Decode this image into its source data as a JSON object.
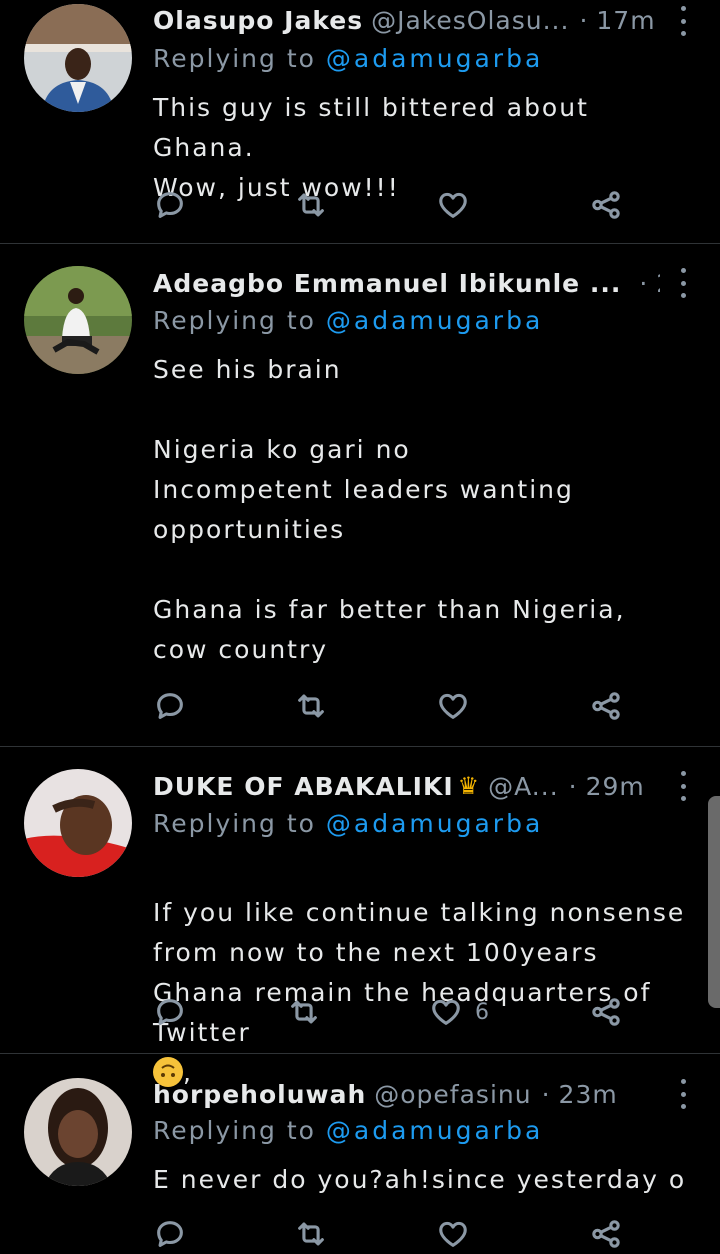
{
  "tweets": [
    {
      "name": "Olasupo Jakes",
      "handle": "@JakesOlasu...",
      "time": "17m",
      "replying_label": "Replying to",
      "replying_to": "@adamugarba",
      "text": "This guy is still bittered about Ghana.\nWow, just wow!!!",
      "like_count": ""
    },
    {
      "name": "Adeagbo Emmanuel Ibikunle ...",
      "handle": "",
      "time": "24m",
      "replying_label": "Replying to",
      "replying_to": "@adamugarba",
      "text": "See his brain\n\nNigeria ko gari no\nIncompetent leaders wanting opportunities\n\nGhana is far better than Nigeria, cow country",
      "like_count": ""
    },
    {
      "name": "DUKE OF ABAKALIKI",
      "handle": "@A...",
      "time": "29m",
      "replying_label": "Replying to",
      "replying_to": "@adamugarba",
      "text": "If you like continue talking nonsense from now to the next 100years Ghana remain the headquarters of Twitter",
      "text_suffix": ",",
      "like_count": "6"
    },
    {
      "name": "horpeholuwah",
      "handle": "@opefasinu",
      "time": "23m",
      "replying_label": "Replying to",
      "replying_to": "@adamugarba",
      "text": "E never do you?ah!since yesterday o",
      "like_count": ""
    }
  ],
  "icons": {
    "reply": "reply-icon",
    "retweet": "retweet-icon",
    "like": "heart-icon",
    "share": "share-icon",
    "more": "more-vertical-icon"
  },
  "colors": {
    "background": "#000000",
    "text": "#e7e9ea",
    "secondary": "#8b98a5",
    "mention": "#1d9bf0",
    "divider": "#2f3336"
  }
}
